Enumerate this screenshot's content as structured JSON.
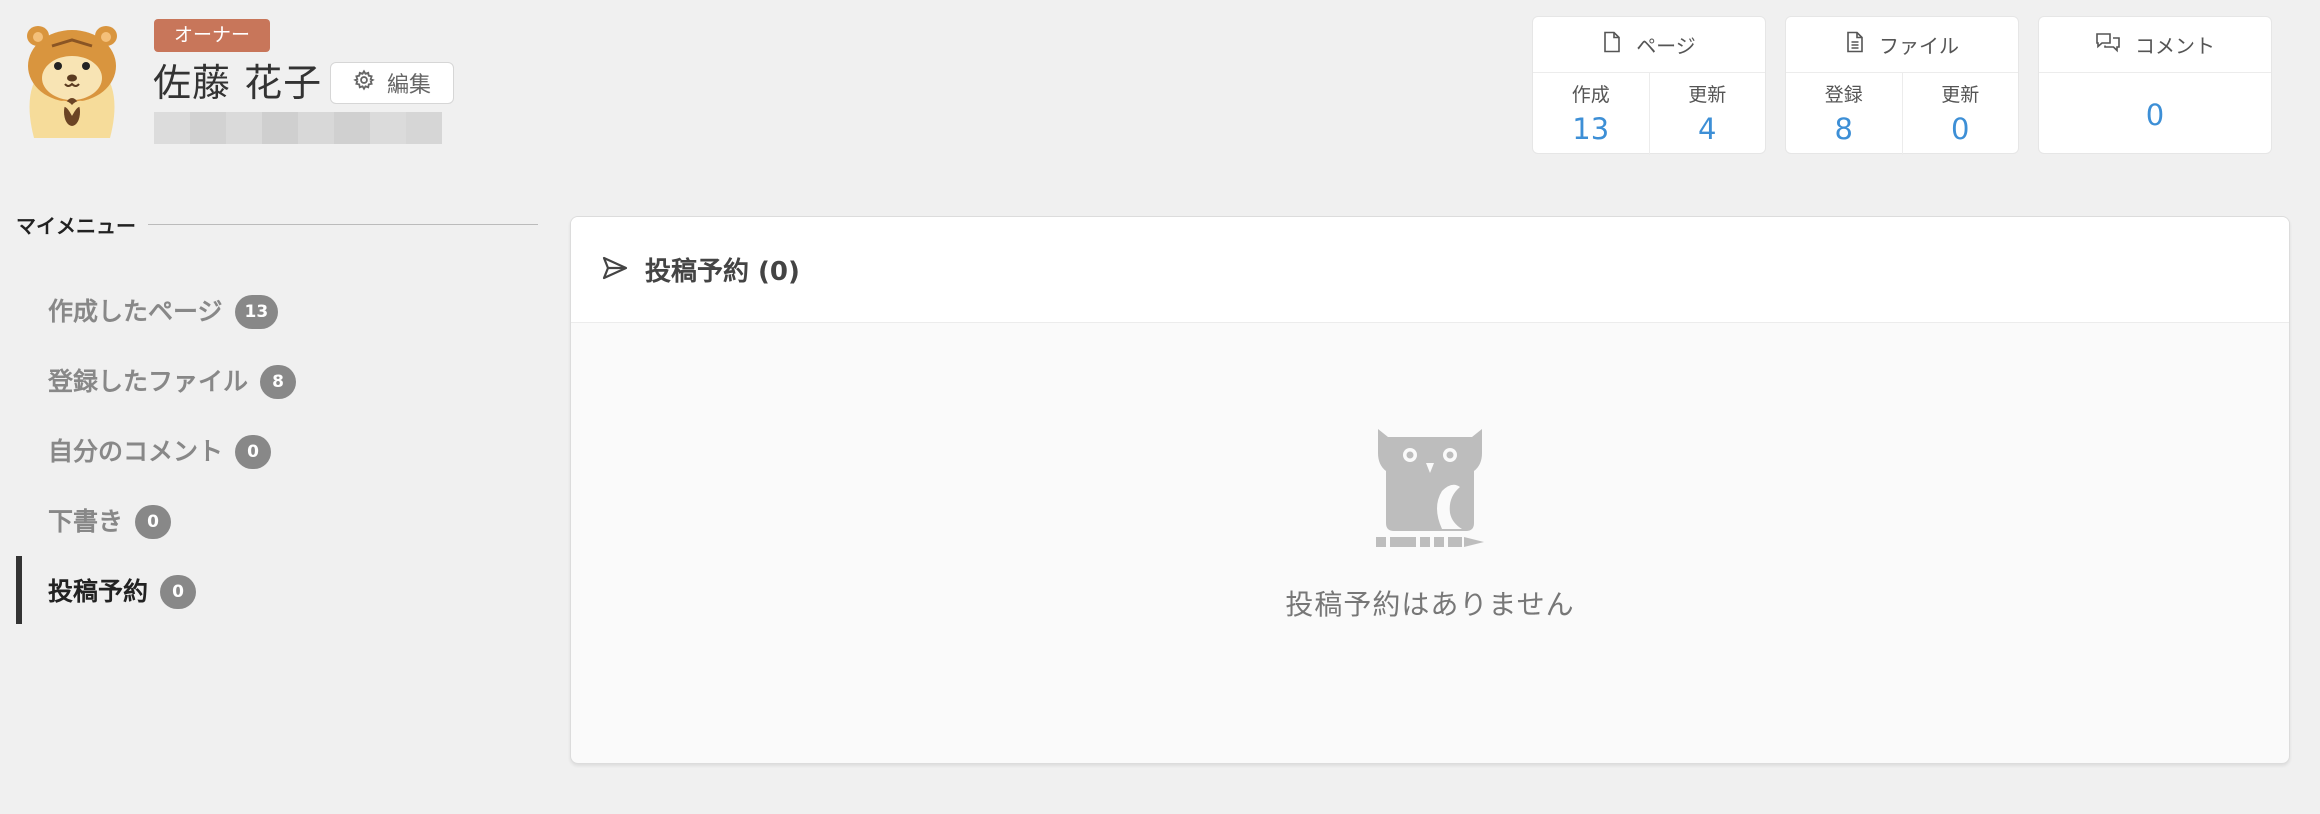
{
  "profile": {
    "role_badge": "オーナー",
    "name": "佐藤 花子",
    "edit_label": "編集"
  },
  "stats": {
    "pages": {
      "title": "ページ",
      "created_label": "作成",
      "created_value": "13",
      "updated_label": "更新",
      "updated_value": "4"
    },
    "files": {
      "title": "ファイル",
      "registered_label": "登録",
      "registered_value": "8",
      "updated_label": "更新",
      "updated_value": "0"
    },
    "comments": {
      "title": "コメント",
      "value": "0"
    }
  },
  "sidebar": {
    "heading": "マイメニュー",
    "items": [
      {
        "label": "作成したページ",
        "count": "13"
      },
      {
        "label": "登録したファイル",
        "count": "8"
      },
      {
        "label": "自分のコメント",
        "count": "0"
      },
      {
        "label": "下書き",
        "count": "0"
      },
      {
        "label": "投稿予約",
        "count": "0"
      }
    ],
    "active_index": 4
  },
  "main": {
    "title": "投稿予約 (0)",
    "empty_message": "投稿予約はありません"
  },
  "icons": {
    "edit": "gear-icon",
    "pages": "file-icon",
    "files": "file-text-icon",
    "comments": "comments-icon",
    "panel": "send-icon",
    "empty": "owl-icon"
  },
  "colors": {
    "accent": "#3d8fd6",
    "role_badge": "#c8765a",
    "count_badge": "#888888"
  }
}
